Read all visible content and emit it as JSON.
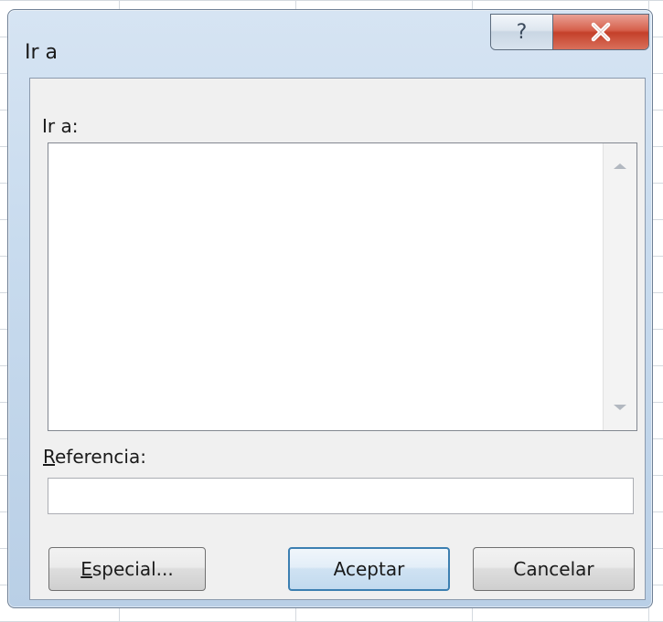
{
  "dialog": {
    "title": "Ir a",
    "help_glyph": "?",
    "close_glyph": "✕"
  },
  "goto": {
    "label": "Ir a:",
    "items": []
  },
  "reference": {
    "label_accel": "R",
    "label_rest": "eferencia:",
    "value": ""
  },
  "buttons": {
    "special_accel": "E",
    "special_rest": "special...",
    "accept": "Aceptar",
    "cancel": "Cancelar"
  }
}
